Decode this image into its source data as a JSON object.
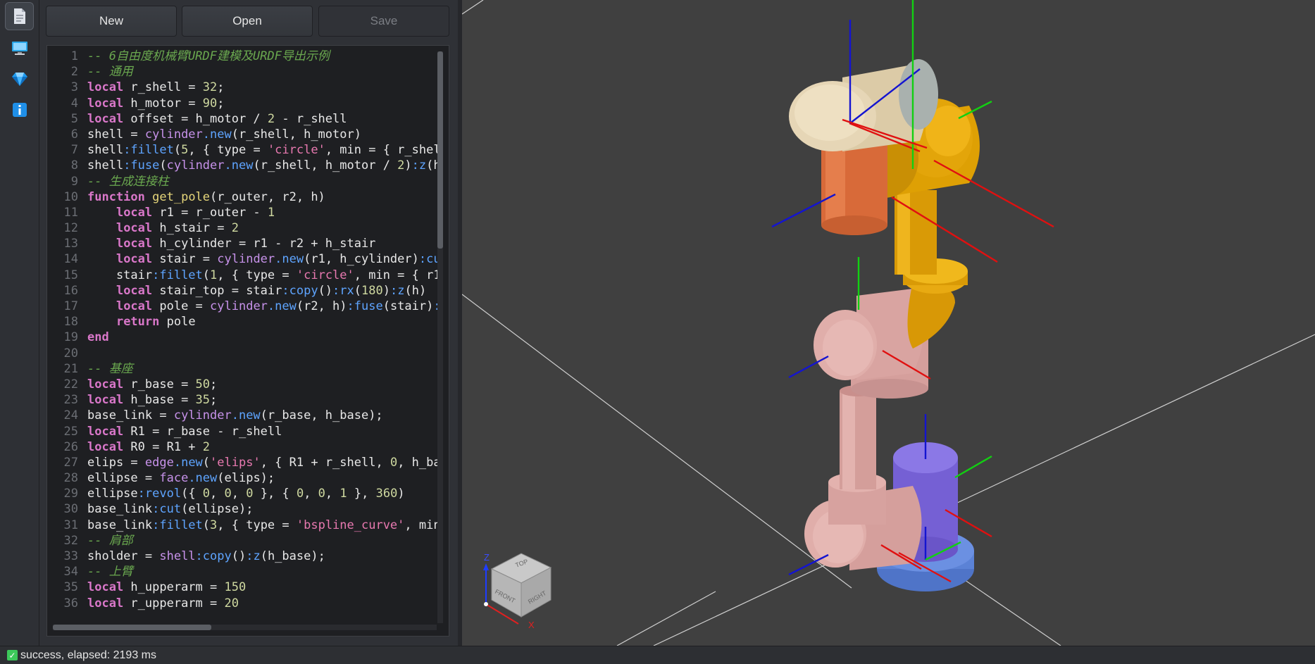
{
  "toolbar": {
    "new_label": "New",
    "open_label": "Open",
    "save_label": "Save"
  },
  "sidebar": {
    "icons": [
      "document-icon",
      "monitor-icon",
      "gem-icon",
      "info-icon"
    ]
  },
  "status": {
    "text": "success, elapsed: 2193 ms",
    "state": "success"
  },
  "viewcube": {
    "top": "TOP",
    "front": "FRONT",
    "right": "RIGHT",
    "axis_z": "Z",
    "axis_x": "X"
  },
  "colors": {
    "shell_top": "#e3d4b2",
    "orange": "#d9703f",
    "yellow": "#e0a106",
    "pink": "#d9a3a0",
    "purple": "#7a65d8",
    "base": "#5b82d6",
    "axis_x": "#e01010",
    "axis_y": "#12d012",
    "axis_z": "#1414d0"
  },
  "code": [
    [
      [
        "c",
        "-- 6自由度机械臂URDF建模及URDF导出示例"
      ]
    ],
    [
      [
        "c",
        "-- 通用"
      ]
    ],
    [
      [
        "k",
        "local"
      ],
      [
        "t",
        " r_shell = "
      ],
      [
        "n",
        "32"
      ],
      [
        "t",
        ";"
      ]
    ],
    [
      [
        "k",
        "local"
      ],
      [
        "t",
        " h_motor = "
      ],
      [
        "n",
        "90"
      ],
      [
        "t",
        ";"
      ]
    ],
    [
      [
        "k",
        "local"
      ],
      [
        "t",
        " offset = h_motor / "
      ],
      [
        "n",
        "2"
      ],
      [
        "t",
        " - r_shell"
      ]
    ],
    [
      [
        "t",
        "shell = "
      ],
      [
        "f",
        "cylinder"
      ],
      [
        "m",
        ".new"
      ],
      [
        "t",
        "(r_shell, h_motor)"
      ]
    ],
    [
      [
        "t",
        "shell"
      ],
      [
        "m",
        ":fillet"
      ],
      [
        "t",
        "("
      ],
      [
        "n",
        "5"
      ],
      [
        "t",
        ", { type = "
      ],
      [
        "s",
        "'circle'"
      ],
      [
        "t",
        ", min = { r_shell"
      ]
    ],
    [
      [
        "t",
        "shell"
      ],
      [
        "m",
        ":fuse"
      ],
      [
        "t",
        "("
      ],
      [
        "f",
        "cylinder"
      ],
      [
        "m",
        ".new"
      ],
      [
        "t",
        "(r_shell, h_motor / "
      ],
      [
        "n",
        "2"
      ],
      [
        "t",
        ")"
      ],
      [
        "m",
        ":z"
      ],
      [
        "t",
        "(h_"
      ]
    ],
    [
      [
        "c",
        "-- 生成连接柱"
      ]
    ],
    [
      [
        "k",
        "function"
      ],
      [
        "t",
        " "
      ],
      [
        "fn",
        "get_pole"
      ],
      [
        "t",
        "(r_outer, r2, h)"
      ]
    ],
    [
      [
        "t",
        "    "
      ],
      [
        "k",
        "local"
      ],
      [
        "t",
        " r1 = r_outer - "
      ],
      [
        "n",
        "1"
      ]
    ],
    [
      [
        "t",
        "    "
      ],
      [
        "k",
        "local"
      ],
      [
        "t",
        " h_stair = "
      ],
      [
        "n",
        "2"
      ]
    ],
    [
      [
        "t",
        "    "
      ],
      [
        "k",
        "local"
      ],
      [
        "t",
        " h_cylinder = r1 - r2 + h_stair"
      ]
    ],
    [
      [
        "t",
        "    "
      ],
      [
        "k",
        "local"
      ],
      [
        "t",
        " stair = "
      ],
      [
        "f",
        "cylinder"
      ],
      [
        "m",
        ".new"
      ],
      [
        "t",
        "(r1, h_cylinder)"
      ],
      [
        "m",
        ":cut"
      ]
    ],
    [
      [
        "t",
        "    stair"
      ],
      [
        "m",
        ":fillet"
      ],
      [
        "t",
        "("
      ],
      [
        "n",
        "1"
      ],
      [
        "t",
        ", { type = "
      ],
      [
        "s",
        "'circle'"
      ],
      [
        "t",
        ", min = { r1"
      ]
    ],
    [
      [
        "t",
        "    "
      ],
      [
        "k",
        "local"
      ],
      [
        "t",
        " stair_top = stair"
      ],
      [
        "m",
        ":copy"
      ],
      [
        "t",
        "()"
      ],
      [
        "m",
        ":rx"
      ],
      [
        "t",
        "("
      ],
      [
        "n",
        "180"
      ],
      [
        "t",
        ")"
      ],
      [
        "m",
        ":z"
      ],
      [
        "t",
        "(h)"
      ]
    ],
    [
      [
        "t",
        "    "
      ],
      [
        "k",
        "local"
      ],
      [
        "t",
        " pole = "
      ],
      [
        "f",
        "cylinder"
      ],
      [
        "m",
        ".new"
      ],
      [
        "t",
        "(r2, h)"
      ],
      [
        "m",
        ":fuse"
      ],
      [
        "t",
        "(stair)"
      ],
      [
        "m",
        ":"
      ]
    ],
    [
      [
        "t",
        "    "
      ],
      [
        "k",
        "return"
      ],
      [
        "t",
        " pole"
      ]
    ],
    [
      [
        "k",
        "end"
      ]
    ],
    [
      [
        "t",
        ""
      ]
    ],
    [
      [
        "c",
        "-- 基座"
      ]
    ],
    [
      [
        "k",
        "local"
      ],
      [
        "t",
        " r_base = "
      ],
      [
        "n",
        "50"
      ],
      [
        "t",
        ";"
      ]
    ],
    [
      [
        "k",
        "local"
      ],
      [
        "t",
        " h_base = "
      ],
      [
        "n",
        "35"
      ],
      [
        "t",
        ";"
      ]
    ],
    [
      [
        "t",
        "base_link = "
      ],
      [
        "f",
        "cylinder"
      ],
      [
        "m",
        ".new"
      ],
      [
        "t",
        "(r_base, h_base);"
      ]
    ],
    [
      [
        "k",
        "local"
      ],
      [
        "t",
        " R1 = r_base - r_shell"
      ]
    ],
    [
      [
        "k",
        "local"
      ],
      [
        "t",
        " R0 = R1 + "
      ],
      [
        "n",
        "2"
      ]
    ],
    [
      [
        "t",
        "elips = "
      ],
      [
        "f",
        "edge"
      ],
      [
        "m",
        ".new"
      ],
      [
        "t",
        "("
      ],
      [
        "s",
        "'elips'"
      ],
      [
        "t",
        ", { R1 + r_shell, "
      ],
      [
        "n",
        "0"
      ],
      [
        "t",
        ", h_bas"
      ]
    ],
    [
      [
        "t",
        "ellipse = "
      ],
      [
        "f",
        "face"
      ],
      [
        "m",
        ".new"
      ],
      [
        "t",
        "(elips);"
      ]
    ],
    [
      [
        "t",
        "ellipse"
      ],
      [
        "m",
        ":revol"
      ],
      [
        "t",
        "({ "
      ],
      [
        "n",
        "0"
      ],
      [
        "t",
        ", "
      ],
      [
        "n",
        "0"
      ],
      [
        "t",
        ", "
      ],
      [
        "n",
        "0"
      ],
      [
        "t",
        " }, { "
      ],
      [
        "n",
        "0"
      ],
      [
        "t",
        ", "
      ],
      [
        "n",
        "0"
      ],
      [
        "t",
        ", "
      ],
      [
        "n",
        "1"
      ],
      [
        "t",
        " }, "
      ],
      [
        "n",
        "360"
      ],
      [
        "t",
        ")"
      ]
    ],
    [
      [
        "t",
        "base_link"
      ],
      [
        "m",
        ":cut"
      ],
      [
        "t",
        "(ellipse);"
      ]
    ],
    [
      [
        "t",
        "base_link"
      ],
      [
        "m",
        ":fillet"
      ],
      [
        "t",
        "("
      ],
      [
        "n",
        "3"
      ],
      [
        "t",
        ", { type = "
      ],
      [
        "s",
        "'bspline_curve'"
      ],
      [
        "t",
        ", min"
      ]
    ],
    [
      [
        "c",
        "-- 肩部"
      ]
    ],
    [
      [
        "t",
        "sholder = "
      ],
      [
        "f",
        "shell"
      ],
      [
        "m",
        ":copy"
      ],
      [
        "t",
        "()"
      ],
      [
        "m",
        ":z"
      ],
      [
        "t",
        "(h_base);"
      ]
    ],
    [
      [
        "c",
        "-- 上臂"
      ]
    ],
    [
      [
        "k",
        "local"
      ],
      [
        "t",
        " h_upperarm = "
      ],
      [
        "n",
        "150"
      ]
    ],
    [
      [
        "k",
        "local"
      ],
      [
        "t",
        " r_upperarm = "
      ],
      [
        "n",
        "20"
      ]
    ]
  ],
  "line_numbers": [
    "1",
    "2",
    "3",
    "4",
    "5",
    "6",
    "7",
    "8",
    "9",
    "10",
    "11",
    "12",
    "13",
    "14",
    "15",
    "16",
    "17",
    "18",
    "19",
    "20",
    "21",
    "22",
    "23",
    "24",
    "25",
    "26",
    "27",
    "28",
    "29",
    "30",
    "31",
    "32",
    "33",
    "34",
    "35",
    "36"
  ]
}
